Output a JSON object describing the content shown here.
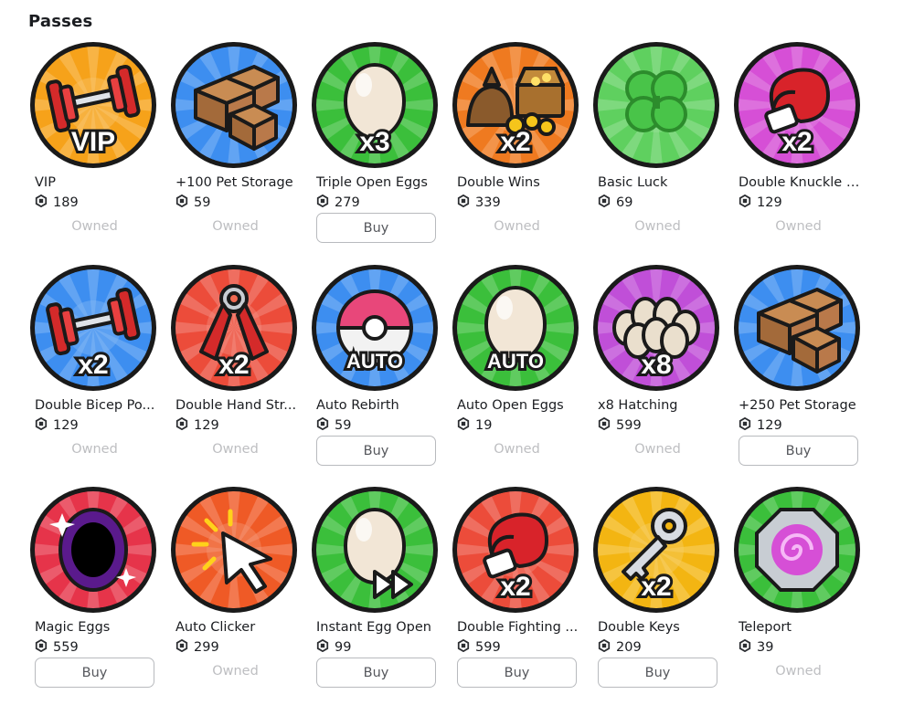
{
  "section_title": "Passes",
  "passes": [
    {
      "name": "VIP",
      "price": "189",
      "status": "Owned",
      "bg": "#f6a21a",
      "icon": "dumbbell-icon",
      "badge": "VIP"
    },
    {
      "name": "+100 Pet Storage",
      "price": "59",
      "status": "Owned",
      "bg": "#3d8ef0",
      "icon": "boxes-icon",
      "badge": ""
    },
    {
      "name": "Triple Open Eggs",
      "price": "279",
      "status": "Buy",
      "bg": "#3bbf3b",
      "icon": "egg-icon",
      "badge": "x3"
    },
    {
      "name": "Double Wins",
      "price": "339",
      "status": "Owned",
      "bg": "#ef7a20",
      "icon": "treasure-icon",
      "badge": "x2"
    },
    {
      "name": "Basic Luck",
      "price": "69",
      "status": "Owned",
      "bg": "#5fd05f",
      "icon": "clover-icon",
      "badge": ""
    },
    {
      "name": "Double Knuckle S...",
      "price": "129",
      "status": "Owned",
      "bg": "#d64fd6",
      "icon": "boxing-glove-icon",
      "badge": "x2"
    },
    {
      "name": "Double Bicep Po...",
      "price": "129",
      "status": "Owned",
      "bg": "#3d8ef0",
      "icon": "dumbbell-icon",
      "badge": "x2"
    },
    {
      "name": "Double Hand Str...",
      "price": "129",
      "status": "Owned",
      "bg": "#ec4c3a",
      "icon": "hand-gripper-icon",
      "badge": "x2"
    },
    {
      "name": "Auto Rebirth",
      "price": "59",
      "status": "Buy",
      "bg": "#3d8ef0",
      "icon": "rebirth-icon",
      "badge": "AUTO"
    },
    {
      "name": "Auto Open Eggs",
      "price": "19",
      "status": "Owned",
      "bg": "#3bbf3b",
      "icon": "egg-icon",
      "badge": "AUTO"
    },
    {
      "name": "x8 Hatching",
      "price": "599",
      "status": "Owned",
      "bg": "#c04fd8",
      "icon": "eggs-pile-icon",
      "badge": "x8"
    },
    {
      "name": "+250 Pet Storage",
      "price": "129",
      "status": "Buy",
      "bg": "#3d8ef0",
      "icon": "boxes-icon",
      "badge": ""
    },
    {
      "name": "Magic Eggs",
      "price": "559",
      "status": "Buy",
      "bg": "#e6344a",
      "icon": "portal-icon",
      "badge": ""
    },
    {
      "name": "Auto Clicker",
      "price": "299",
      "status": "Owned",
      "bg": "#ef5a26",
      "icon": "cursor-icon",
      "badge": ""
    },
    {
      "name": "Instant Egg Open",
      "price": "99",
      "status": "Buy",
      "bg": "#3bbf3b",
      "icon": "egg-icon",
      "badge": "fast-forward"
    },
    {
      "name": "Double Fighting ...",
      "price": "599",
      "status": "Buy",
      "bg": "#ec4c3a",
      "icon": "boxing-glove-icon",
      "badge": "x2"
    },
    {
      "name": "Double Keys",
      "price": "209",
      "status": "Buy",
      "bg": "#f3b512",
      "icon": "key-icon",
      "badge": "x2"
    },
    {
      "name": "Teleport",
      "price": "39",
      "status": "Owned",
      "bg": "#3bbf3b",
      "icon": "teleport-icon",
      "badge": ""
    }
  ]
}
